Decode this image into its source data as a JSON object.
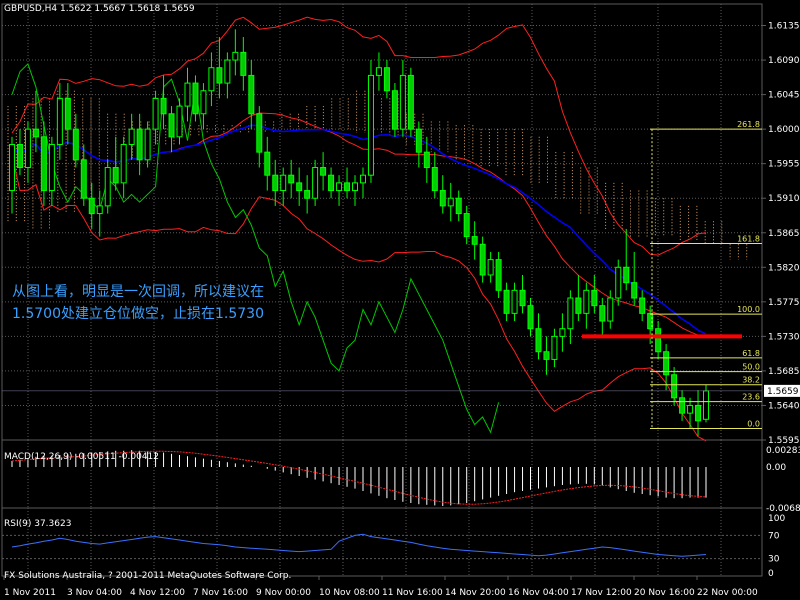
{
  "header": {
    "main": "GBPUSD,H4  1.5622  1.5667  1.5618  1.5659",
    "macd": "MACD(12,26,9) -0.00511 -0.00412",
    "rsi": "RSI(9) 37.3623",
    "footer": "FX Solutions Australia, ? 2001-2011 MetaQuotes Software Corp."
  },
  "annotation": {
    "line1": "从图上看，明显是一次回调，所以建议在",
    "line2": "1.5700处建立仓位做空，止损在1.5730"
  },
  "price_axis": {
    "ticks": [
      "1.6135",
      "1.6090",
      "1.6045",
      "1.6000",
      "1.5955",
      "1.5910",
      "1.5865",
      "1.5820",
      "1.5775",
      "1.5730",
      "1.5685",
      "1.5640",
      "1.5595"
    ],
    "current_price": "1.5659"
  },
  "macd_axis": {
    "ticks": [
      "0.00283",
      "0.00",
      "-0.00683"
    ]
  },
  "rsi_axis": {
    "ticks": [
      "100",
      "70",
      "30",
      "0"
    ]
  },
  "time_axis": {
    "ticks": [
      "1 Nov 2011",
      "3 Nov 04:00",
      "4 Nov 12:00",
      "7 Nov 16:00",
      "9 Nov 00:00",
      "10 Nov 08:00",
      "11 Nov 16:00",
      "14 Nov 20:00",
      "16 Nov 04:00",
      "17 Nov 12:00",
      "20 Nov 16:00",
      "22 Nov 00:00"
    ]
  },
  "fibonacci": {
    "levels": [
      {
        "label": "261.8",
        "price": 1.6
      },
      {
        "label": "161.8",
        "price": 1.5851
      },
      {
        "label": "100.0",
        "price": 1.5759
      },
      {
        "label": "61.8",
        "price": 1.5702
      },
      {
        "label": "50.0",
        "price": 1.5684
      },
      {
        "label": "38.2",
        "price": 1.5667
      },
      {
        "label": "23.6",
        "price": 1.5645
      },
      {
        "label": "0.0",
        "price": 1.561
      }
    ]
  },
  "colors": {
    "background": "#000000",
    "grid": "#5a5a5a",
    "bull_candle": "#00ff00",
    "bear_candle": "#00cc00",
    "bollinger": "#ff2020",
    "ma_blue": "#0000ff",
    "green_line": "#00c800",
    "fib": "#e6e65a",
    "stop_line": "#ff0000",
    "cloud": "#e0a060",
    "macd_bars": "#ffffff",
    "macd_signal": "#ff2020",
    "rsi_line": "#3a70ff"
  },
  "chart_data": {
    "type": "candlestick",
    "symbol": "GBPUSD",
    "timeframe": "H4",
    "ylim": [
      1.5595,
      1.615
    ],
    "stop_line_price": 1.573,
    "candles": [
      [
        1.592,
        1.599,
        1.589,
        1.598
      ],
      [
        1.598,
        1.6,
        1.594,
        1.595
      ],
      [
        1.595,
        1.601,
        1.593,
        1.6
      ],
      [
        1.6,
        1.605,
        1.597,
        1.599
      ],
      [
        1.599,
        1.601,
        1.59,
        1.592
      ],
      [
        1.592,
        1.599,
        1.59,
        1.598
      ],
      [
        1.598,
        1.606,
        1.596,
        1.604
      ],
      [
        1.604,
        1.606,
        1.598,
        1.6
      ],
      [
        1.6,
        1.602,
        1.595,
        1.596
      ],
      [
        1.596,
        1.598,
        1.59,
        1.591
      ],
      [
        1.591,
        1.593,
        1.587,
        1.589
      ],
      [
        1.589,
        1.592,
        1.586,
        1.59
      ],
      [
        1.59,
        1.596,
        1.589,
        1.595
      ],
      [
        1.595,
        1.599,
        1.592,
        1.593
      ],
      [
        1.593,
        1.599,
        1.591,
        1.598
      ],
      [
        1.598,
        1.602,
        1.596,
        1.6
      ],
      [
        1.6,
        1.602,
        1.594,
        1.596
      ],
      [
        1.596,
        1.601,
        1.595,
        1.6
      ],
      [
        1.6,
        1.605,
        1.598,
        1.604
      ],
      [
        1.604,
        1.607,
        1.6,
        1.602
      ],
      [
        1.602,
        1.603,
        1.597,
        1.599
      ],
      [
        1.599,
        1.604,
        1.598,
        1.603
      ],
      [
        1.603,
        1.608,
        1.601,
        1.606
      ],
      [
        1.606,
        1.607,
        1.601,
        1.602
      ],
      [
        1.602,
        1.606,
        1.6,
        1.605
      ],
      [
        1.605,
        1.61,
        1.603,
        1.608
      ],
      [
        1.608,
        1.612,
        1.604,
        1.606
      ],
      [
        1.606,
        1.61,
        1.604,
        1.609
      ],
      [
        1.609,
        1.613,
        1.607,
        1.61
      ],
      [
        1.61,
        1.612,
        1.605,
        1.607
      ],
      [
        1.607,
        1.609,
        1.6,
        1.602
      ],
      [
        1.602,
        1.603,
        1.595,
        1.597
      ],
      [
        1.597,
        1.599,
        1.592,
        1.594
      ],
      [
        1.594,
        1.596,
        1.59,
        1.592
      ],
      [
        1.592,
        1.595,
        1.59,
        1.594
      ],
      [
        1.594,
        1.596,
        1.591,
        1.593
      ],
      [
        1.593,
        1.595,
        1.59,
        1.592
      ],
      [
        1.592,
        1.594,
        1.589,
        1.591
      ],
      [
        1.591,
        1.596,
        1.59,
        1.595
      ],
      [
        1.595,
        1.597,
        1.592,
        1.594
      ],
      [
        1.594,
        1.595,
        1.591,
        1.592
      ],
      [
        1.592,
        1.594,
        1.59,
        1.593
      ],
      [
        1.593,
        1.595,
        1.591,
        1.592
      ],
      [
        1.592,
        1.594,
        1.59,
        1.593
      ],
      [
        1.593,
        1.595,
        1.591,
        1.594
      ],
      [
        1.594,
        1.609,
        1.593,
        1.607
      ],
      [
        1.607,
        1.61,
        1.605,
        1.608
      ],
      [
        1.608,
        1.609,
        1.604,
        1.605
      ],
      [
        1.605,
        1.606,
        1.599,
        1.6
      ],
      [
        1.6,
        1.609,
        1.599,
        1.607
      ],
      [
        1.607,
        1.608,
        1.599,
        1.6
      ],
      [
        1.6,
        1.601,
        1.595,
        1.597
      ],
      [
        1.597,
        1.599,
        1.593,
        1.595
      ],
      [
        1.595,
        1.597,
        1.591,
        1.592
      ],
      [
        1.592,
        1.594,
        1.589,
        1.59
      ],
      [
        1.59,
        1.593,
        1.588,
        1.591
      ],
      [
        1.591,
        1.592,
        1.588,
        1.589
      ],
      [
        1.589,
        1.59,
        1.585,
        1.586
      ],
      [
        1.586,
        1.588,
        1.583,
        1.585
      ],
      [
        1.585,
        1.586,
        1.58,
        1.581
      ],
      [
        1.581,
        1.584,
        1.58,
        1.583
      ],
      [
        1.583,
        1.584,
        1.578,
        1.579
      ],
      [
        1.579,
        1.58,
        1.575,
        1.576
      ],
      [
        1.576,
        1.58,
        1.575,
        1.579
      ],
      [
        1.579,
        1.581,
        1.576,
        1.577
      ],
      [
        1.577,
        1.578,
        1.573,
        1.574
      ],
      [
        1.574,
        1.576,
        1.57,
        1.571
      ],
      [
        1.571,
        1.573,
        1.568,
        1.57
      ],
      [
        1.57,
        1.574,
        1.569,
        1.573
      ],
      [
        1.573,
        1.576,
        1.571,
        1.574
      ],
      [
        1.574,
        1.579,
        1.572,
        1.578
      ],
      [
        1.578,
        1.581,
        1.575,
        1.576
      ],
      [
        1.576,
        1.58,
        1.574,
        1.579
      ],
      [
        1.579,
        1.581,
        1.576,
        1.577
      ],
      [
        1.577,
        1.578,
        1.573,
        1.575
      ],
      [
        1.575,
        1.579,
        1.574,
        1.578
      ],
      [
        1.578,
        1.583,
        1.577,
        1.582
      ],
      [
        1.582,
        1.587,
        1.579,
        1.58
      ],
      [
        1.58,
        1.584,
        1.577,
        1.578
      ],
      [
        1.578,
        1.579,
        1.575,
        1.576
      ],
      [
        1.576,
        1.577,
        1.572,
        1.574
      ],
      [
        1.574,
        1.575,
        1.57,
        1.571
      ],
      [
        1.571,
        1.572,
        1.566,
        1.568
      ],
      [
        1.568,
        1.569,
        1.564,
        1.565
      ],
      [
        1.565,
        1.566,
        1.562,
        1.563
      ],
      [
        1.563,
        1.565,
        1.561,
        1.564
      ],
      [
        1.564,
        1.566,
        1.56,
        1.562
      ],
      [
        1.5622,
        1.5667,
        1.5618,
        1.5659
      ]
    ],
    "macd_histogram": [
      0.001,
      0.0012,
      0.0015,
      0.0017,
      0.0018,
      0.0019,
      0.002,
      0.0021,
      0.0022,
      0.0023,
      0.0024,
      0.0025,
      0.0026,
      0.0027,
      0.0027,
      0.0028,
      0.0027,
      0.0026,
      0.0025,
      0.0024,
      0.0022,
      0.002,
      0.0018,
      0.0016,
      0.0014,
      0.0012,
      0.001,
      0.0008,
      0.0006,
      0.0004,
      0.0002,
      0.0,
      -0.0003,
      -0.0006,
      -0.0009,
      -0.0012,
      -0.0015,
      -0.0018,
      -0.0021,
      -0.0024,
      -0.0027,
      -0.003,
      -0.0033,
      -0.0036,
      -0.004,
      -0.0044,
      -0.0048,
      -0.0052,
      -0.0055,
      -0.0058,
      -0.006,
      -0.0062,
      -0.0063,
      -0.0064,
      -0.0065,
      -0.0064,
      -0.0062,
      -0.006,
      -0.0057,
      -0.0054,
      -0.0051,
      -0.0048,
      -0.0045,
      -0.0042,
      -0.004,
      -0.0038,
      -0.0036,
      -0.0034,
      -0.0032,
      -0.003,
      -0.0029,
      -0.0028,
      -0.0028,
      -0.0029,
      -0.0031,
      -0.0034,
      -0.0037,
      -0.004,
      -0.0043,
      -0.0045,
      -0.0047,
      -0.0049,
      -0.0051,
      -0.0052,
      -0.0052,
      -0.0051,
      -0.0051,
      -0.0051
    ],
    "rsi": [
      50,
      52,
      55,
      57,
      60,
      62,
      65,
      63,
      60,
      58,
      56,
      55,
      57,
      59,
      61,
      63,
      65,
      67,
      68,
      66,
      64,
      62,
      60,
      58,
      56,
      55,
      54,
      52,
      50,
      49,
      48,
      47,
      46,
      45,
      44,
      43,
      42,
      43,
      44,
      45,
      46,
      60,
      65,
      70,
      72,
      68,
      66,
      64,
      62,
      60,
      58,
      55,
      52,
      50,
      48,
      46,
      45,
      44,
      43,
      42,
      41,
      40,
      39,
      38,
      37,
      36,
      35,
      36,
      38,
      40,
      42,
      44,
      46,
      48,
      50,
      49,
      47,
      45,
      43,
      41,
      39,
      37,
      36,
      35,
      34,
      35,
      36,
      37
    ]
  }
}
